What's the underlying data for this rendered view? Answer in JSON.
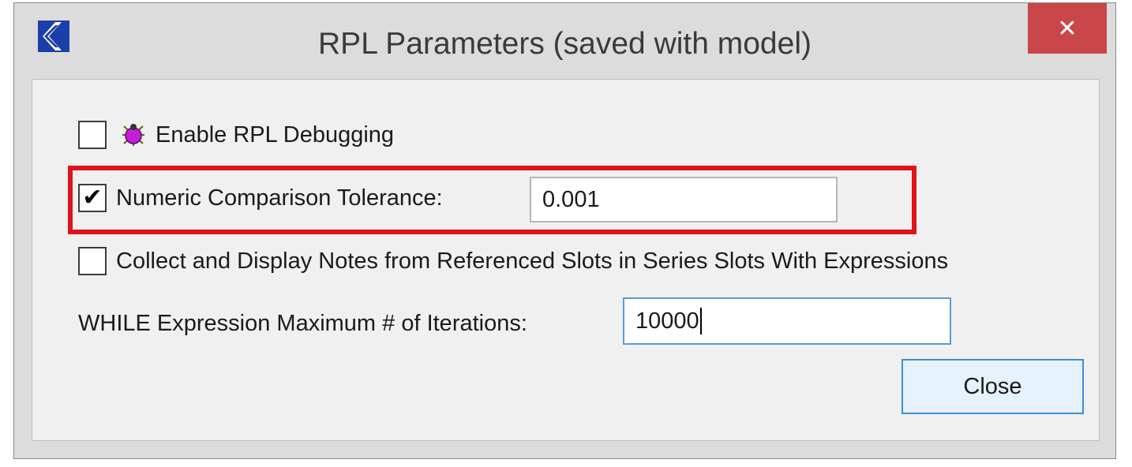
{
  "window": {
    "title": "RPL Parameters (saved with model)",
    "close_glyph": "✕",
    "app_icon": "riverware-logo-icon"
  },
  "options": {
    "debugging": {
      "label": "Enable RPL Debugging",
      "checked": false,
      "icon": "bug-icon",
      "check_glyph": ""
    },
    "tolerance": {
      "label": "Numeric Comparison Tolerance:",
      "checked": true,
      "value": "0.001",
      "check_glyph": "✔"
    },
    "notes": {
      "label": "Collect and Display Notes from Referenced Slots in Series Slots With Expressions",
      "checked": false,
      "check_glyph": ""
    },
    "while_iterations": {
      "label": "WHILE Expression Maximum # of Iterations:",
      "value": "10000"
    }
  },
  "buttons": {
    "close_label": "Close"
  },
  "colors": {
    "highlight": "#e0131c",
    "close_bg": "#c9474a",
    "accent": "#3c8fd6"
  }
}
